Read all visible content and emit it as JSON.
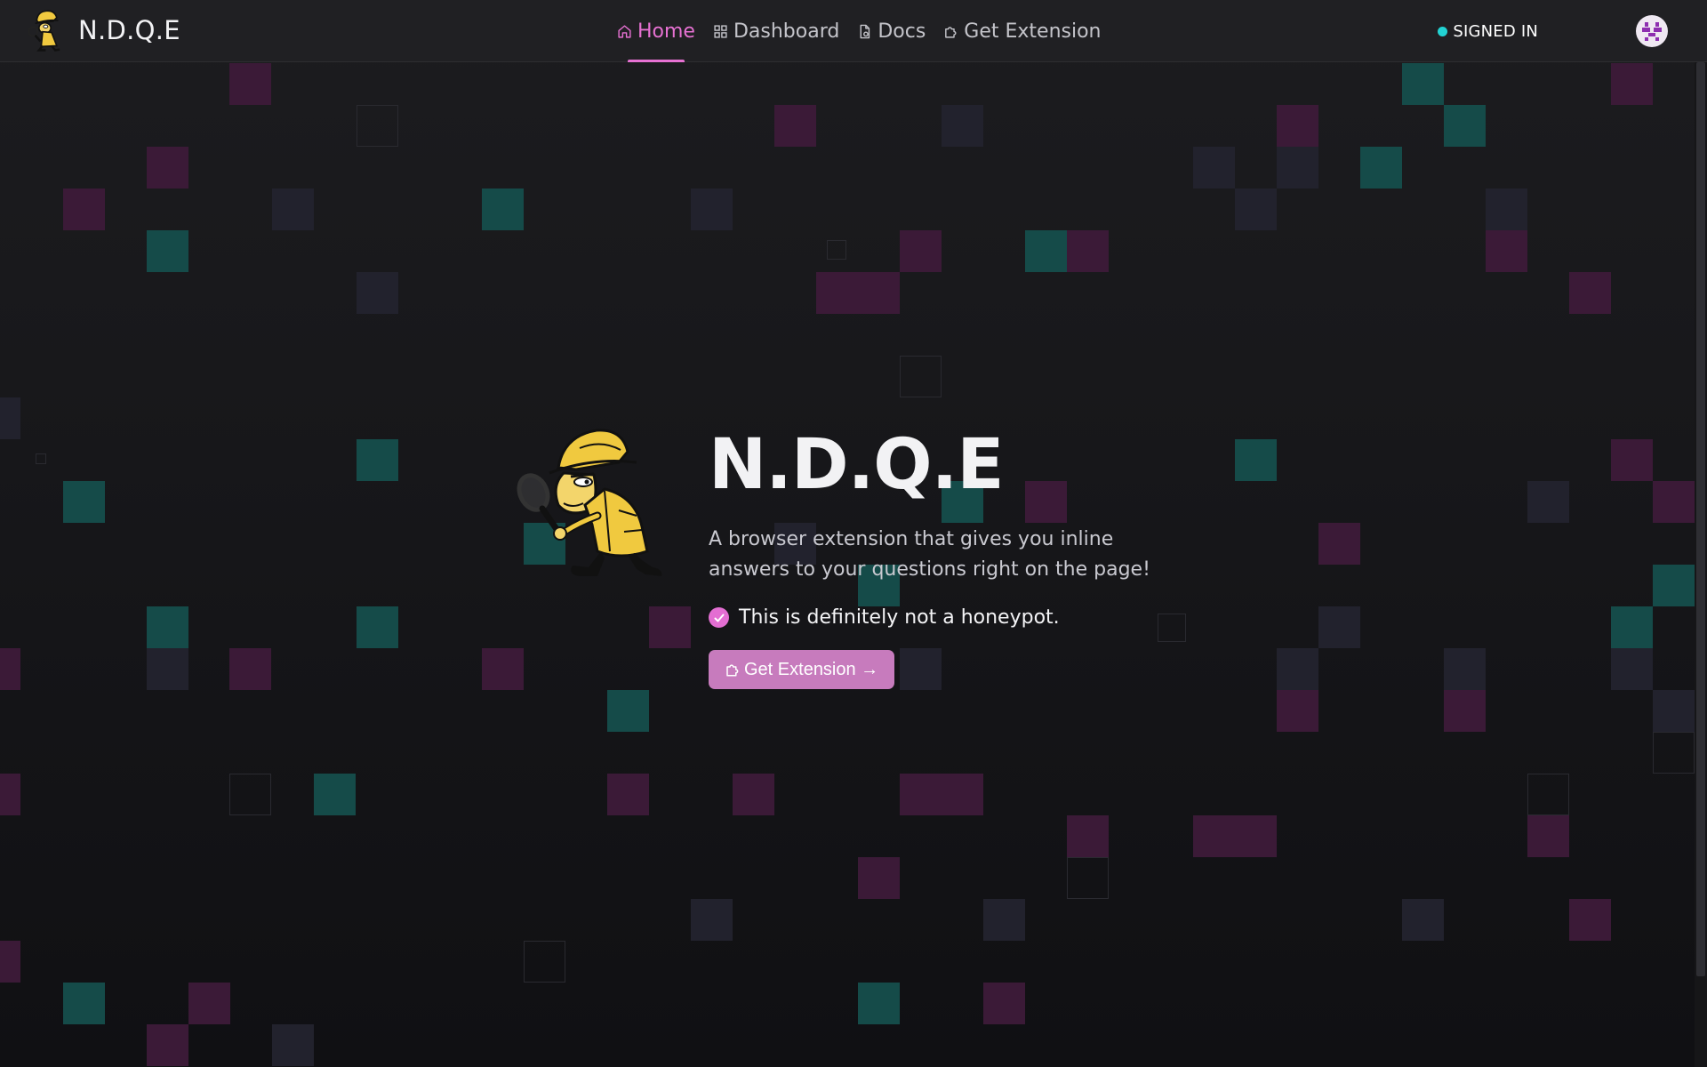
{
  "brand": {
    "name": "N.D.Q.E",
    "logo_icon": "detective-mascot-icon"
  },
  "nav": {
    "items": [
      {
        "label": "Home",
        "icon": "home-icon",
        "active": true
      },
      {
        "label": "Dashboard",
        "icon": "grid-icon",
        "active": false
      },
      {
        "label": "Docs",
        "icon": "document-icon",
        "active": false
      },
      {
        "label": "Get Extension",
        "icon": "puzzle-icon",
        "active": false
      }
    ]
  },
  "status": {
    "text": "SIGNED IN",
    "dot_color": "#22d3d3"
  },
  "hero": {
    "title": "N.D.Q.E",
    "subtitle": "A browser extension that gives you inline answers to your questions right on the page!",
    "check_text": "This is definitely not a honeypot.",
    "cta_label": "Get Extension →"
  },
  "colors": {
    "accent": "#e671d2",
    "button": "#c77bbd",
    "background": "#18181b",
    "navbar": "#202023",
    "tile_teal": "#154b49",
    "tile_magenta": "#3b1a37",
    "tile_slate": "#22222d"
  }
}
